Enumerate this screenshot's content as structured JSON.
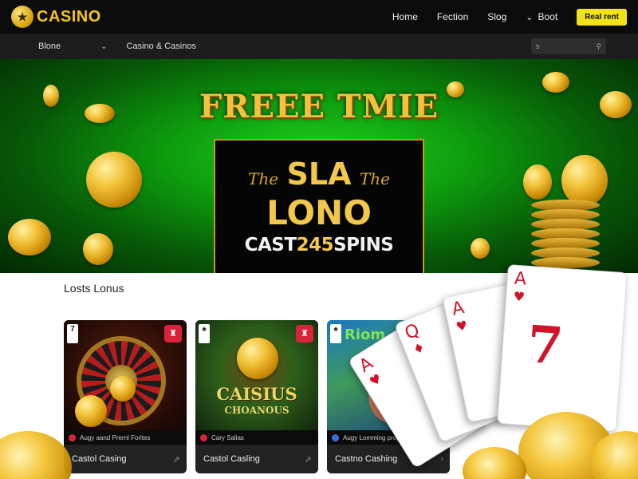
{
  "header": {
    "logo_icon": "★",
    "logo_text": "CASINO",
    "nav": [
      "Home",
      "Fection",
      "Slog"
    ],
    "nav_chevron": "⌄",
    "nav_more": "Boot",
    "cta_label": "Real rent"
  },
  "subbar": {
    "selector_label": "Blone",
    "selector_chevron": "⌄",
    "breadcrumb": "Casino & Casinos",
    "search_placeholder": "s",
    "search_icon": "⚲"
  },
  "hero": {
    "title": "FREEE TMIE",
    "promo_the_left": "The",
    "promo_sla": "SLA",
    "promo_the_right": "The",
    "promo_lono": "LONO",
    "promo_cast": "CAST",
    "promo_number": "245",
    "promo_spins": "SPINS"
  },
  "section": {
    "title": "Losts Lonus"
  },
  "cards": [
    {
      "badge_num": "7",
      "badge_icon": "♜",
      "info": "Augy aand Prernl Forites",
      "title": "Castol Casing",
      "arrow": "⇗"
    },
    {
      "badge_num": "♠",
      "badge_icon": "♜",
      "info": "Cary Salias",
      "title": "Castol Casling",
      "art_title": "CAISIUS",
      "art_subtitle": "CHOANOUS",
      "arrow": "⇗"
    },
    {
      "badge_num": "♠",
      "badge_icon": "♜",
      "info": "Augy Lomming propant",
      "title": "Castno Cashing",
      "art_title": "Riom",
      "arrow": "›"
    }
  ],
  "playing_cards": [
    {
      "rank": "A",
      "suit": "♥"
    },
    {
      "rank": "Q",
      "suit": "♦"
    },
    {
      "rank": "A",
      "suit": "♥"
    },
    {
      "rank": "A",
      "suit": "♥",
      "big": "7"
    }
  ],
  "colors": {
    "brand_gold": "#f5c518",
    "cta_yellow": "#f2e21a",
    "hero_green": "#0c9a0c",
    "card_red": "#d2142b"
  }
}
